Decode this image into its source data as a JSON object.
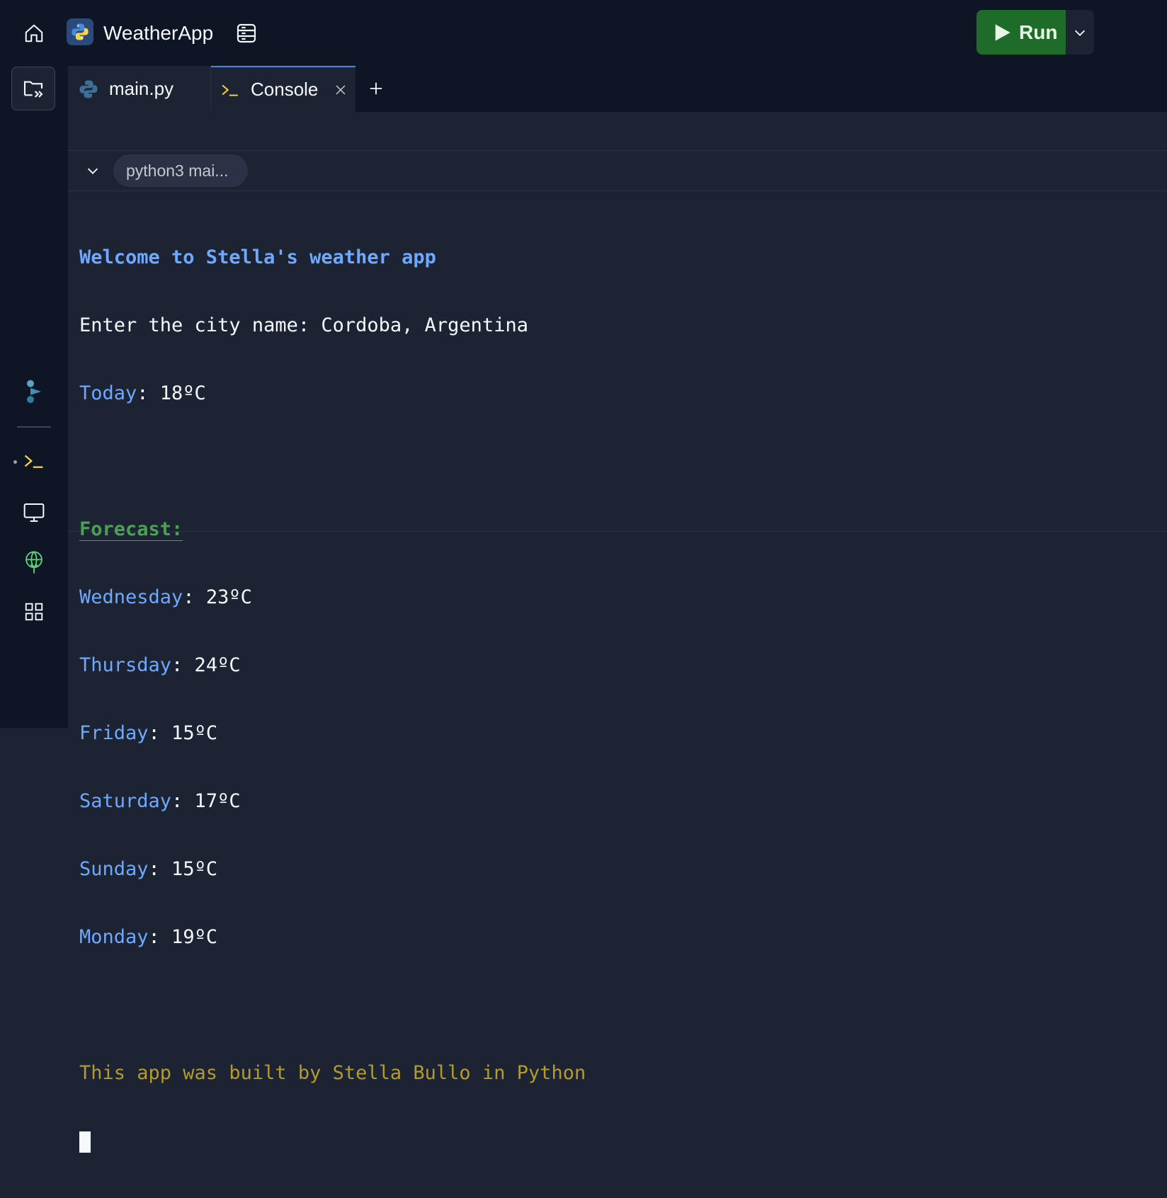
{
  "header": {
    "app_name": "WeatherApp",
    "run_label": "Run"
  },
  "tabs": [
    {
      "label": "main.py",
      "icon": "python-icon"
    },
    {
      "label": "Console",
      "icon": "terminal-icon",
      "active": true
    }
  ],
  "process": {
    "label": "python3 mai..."
  },
  "console": {
    "welcome": "Welcome to Stella's weather app",
    "prompt": "Enter the city name: Cordoba, Argentina",
    "today_label": "Today",
    "today_value": ": 18ºC",
    "forecast_title": "Forecast:",
    "forecast": [
      {
        "day": "Wednesday",
        "value": ": 23ºC"
      },
      {
        "day": "Thursday",
        "value": ": 24ºC"
      },
      {
        "day": "Friday",
        "value": ": 15ºC"
      },
      {
        "day": "Saturday",
        "value": ": 17ºC"
      },
      {
        "day": "Sunday",
        "value": ": 15ºC"
      },
      {
        "day": "Monday",
        "value": ": 19ºC"
      }
    ],
    "credit": "This app was built by Stella Bullo in Python"
  },
  "colors": {
    "accent_blue": "#6fa8ff",
    "forecast_green": "#4aa151",
    "credit_yellow": "#b59a2c",
    "run_green": "#1f6b2a"
  }
}
